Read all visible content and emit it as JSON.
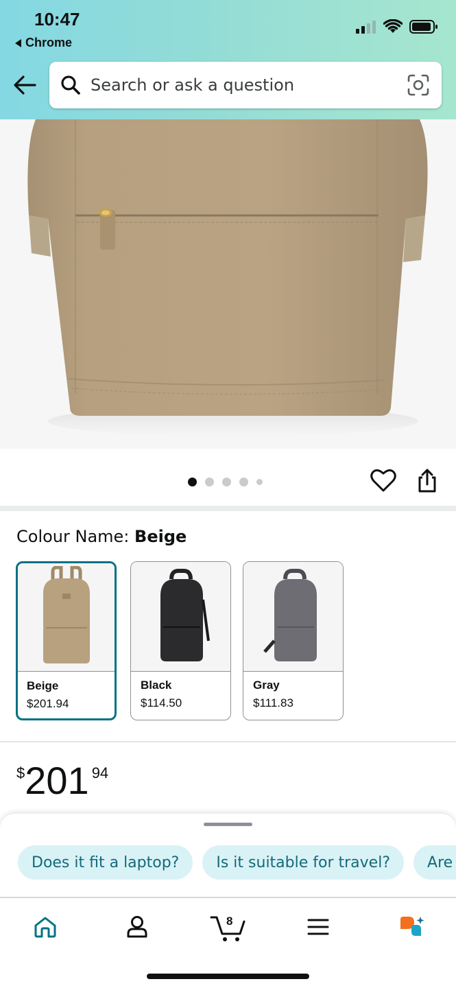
{
  "status_bar": {
    "time": "10:47",
    "back_app": "Chrome"
  },
  "search": {
    "placeholder": "Search or ask a question"
  },
  "product": {
    "image_alt": "beige backpack front view",
    "pager": {
      "total": 5,
      "active_index": 0
    }
  },
  "colour": {
    "label_prefix": "Colour Name: ",
    "selected_name": "Beige",
    "options": [
      {
        "name": "Beige",
        "price": "$201.94",
        "color": "#b7a17f"
      },
      {
        "name": "Black",
        "price": "$114.50",
        "color": "#2b2b2d"
      },
      {
        "name": "Gray",
        "price": "$111.83",
        "color": "#6e6d73"
      }
    ]
  },
  "price": {
    "symbol": "$",
    "whole": "201",
    "fraction": "94"
  },
  "suggestions": [
    "Does it fit a laptop?",
    "Is it suitable for travel?",
    "Are zi"
  ],
  "nav": {
    "items": [
      "home-icon",
      "account-icon",
      "cart-icon",
      "menu-icon",
      "rufus-icon"
    ],
    "cart_count": "8"
  },
  "colors": {
    "accent": "#007185",
    "chip_bg": "#d9f2f6",
    "header_start": "#84d8e3",
    "header_end": "#a6e6cf",
    "rufus_orange": "#f3701f",
    "rufus_teal": "#1fa3c6"
  }
}
